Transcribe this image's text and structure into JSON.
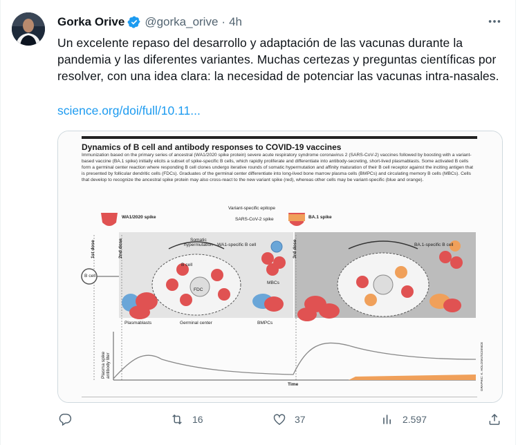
{
  "tweet": {
    "author_name": "Gorka Orive",
    "handle": "@gorka_orive",
    "separator": "·",
    "time": "4h",
    "text": "Un excelente repaso del desarrollo y adaptación de las vacunas durante la pandemia y las diferentes variantes. Muchas certezas y preguntas científicas por resolver, con una idea clara: la necesidad de potenciar las vacunas intra-nasales.",
    "link": "science.org/doi/full/10.11..."
  },
  "figure": {
    "title": "Dynamics of B cell and antibody responses to COVID-19 vaccines",
    "caption": "Immunization based on the primary series of ancestral (WA1/2020 spike protein) severe acute respiratory syndrome coronavirus 2 (SARS-CoV-2) vaccines followed by boosting with a variant-based vaccine (BA.1 spike) initially elicits a subset of spike-specific B cells, which rapidly proliferate and differentiate into antibody-secreting, short-lived plasmablasts. Some activated B cells form a germinal center reaction where responding B cell clones undergo iterative rounds of somatic hypermutation and affinity maturation of their B cell receptor against the inciting antigen that is presented by follicular dendritic cells (FDCs). Graduates of the germinal center differentiate into long-lived bone marrow plasma cells (BMPCs) and circulating memory B cells (MBCs). Cells that develop to recognize the ancestral spike protein may also cross-react to the new variant spike (red), whereas other cells may be variant-specific (blue and orange).",
    "labels": {
      "wa1_spike": "WA1/2020 spike",
      "variant_epitope": "Variant-specific epitope",
      "sars_spike": "SARS-CoV-2 spike",
      "ba1_spike": "BA.1 spike",
      "dose1": "1st dose",
      "dose2": "2nd dose",
      "dose3": "3rd dose",
      "somatic": "Somatic\nhypermutation",
      "wa1_bcell": "WA1-specific B cell",
      "ba1_bcell": "BA.1-specific B cell",
      "b_cell": "B cell",
      "b_cell_gc": "B cell",
      "fdc": "FDC",
      "mbcs": "MBCs",
      "plasmablasts": "Plasmablasts",
      "germinal_center": "Germinal center",
      "bmpcs": "BMPCs",
      "y_axis": "Plasma spike\nantibody titer",
      "x_axis": "Time",
      "credit": "GRAPHIC: K. HOLOSKI/SCIENCE"
    }
  },
  "actions": {
    "reply_count": "",
    "retweet_count": "16",
    "like_count": "37",
    "view_count": "2.597"
  },
  "colors": {
    "link": "#1d9bf0",
    "verified": "#1d9bf0",
    "secondary_text": "#536471"
  }
}
